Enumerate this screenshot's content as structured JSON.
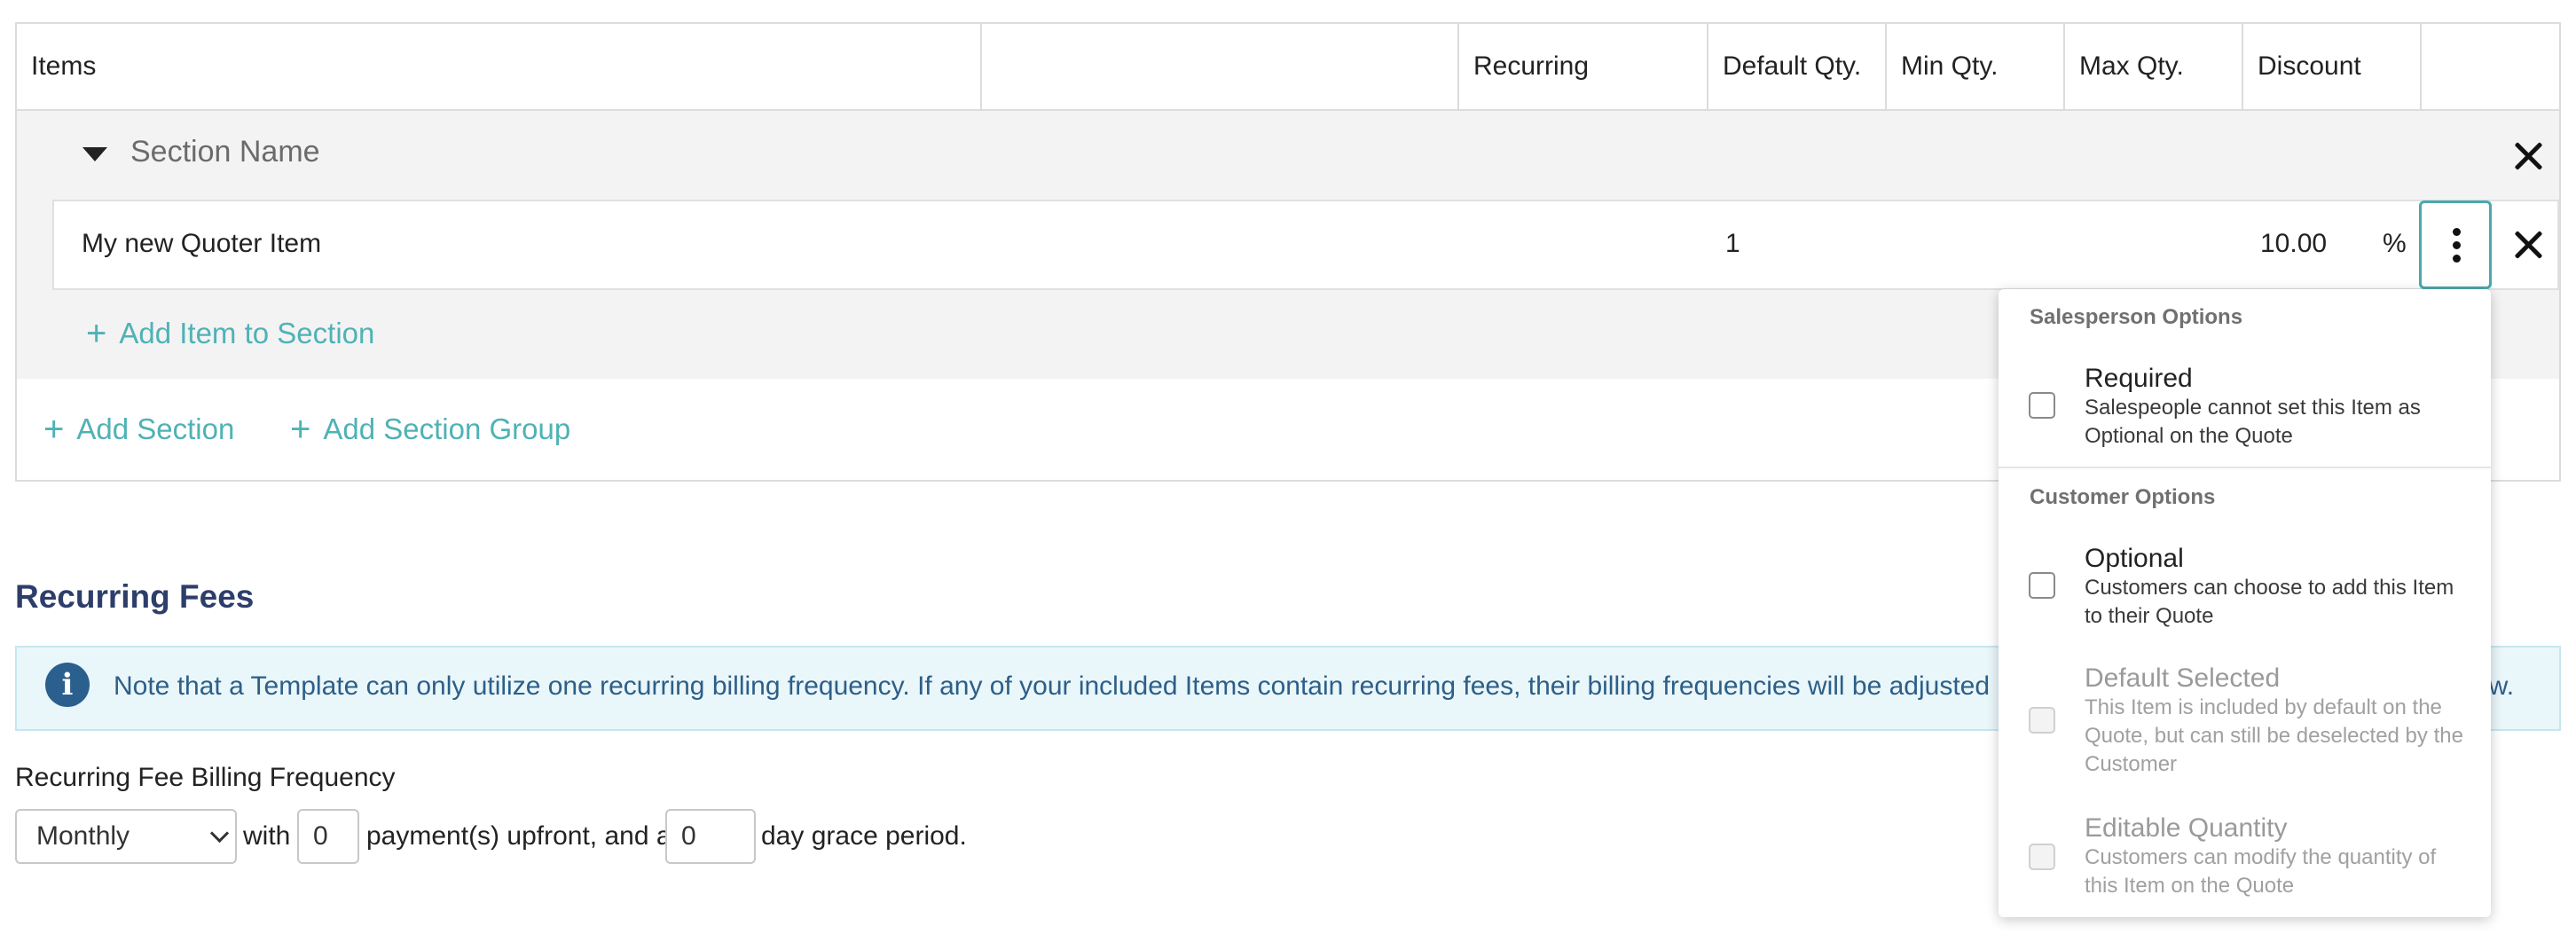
{
  "table": {
    "columns": [
      "Items",
      "",
      "Recurring",
      "Default Qty.",
      "Min Qty.",
      "Max Qty.",
      "Discount",
      ""
    ],
    "section_name": "Section Name",
    "item": {
      "name": "My new Quoter Item",
      "default_qty": "1",
      "discount": "10.00",
      "discount_unit": "%"
    },
    "add_item_to_section": "Add Item to Section",
    "add_section": "Add Section",
    "add_section_group": "Add Section Group"
  },
  "recurring": {
    "title": "Recurring Fees",
    "info": "Note that a Template can only utilize one recurring billing frequency. If any of your included Items contain recurring fees, their billing frequencies will be adjusted in your Q",
    "info_tail": "ow.",
    "frequency_label": "Recurring Fee Billing Frequency",
    "frequency_value": "Monthly",
    "with": "with",
    "upfront_value": "0",
    "upfront_text": "payment(s) upfront, and a",
    "grace_value": "0",
    "grace_text": "day grace period."
  },
  "menu": {
    "salesperson_heading": "Salesperson Options",
    "required_title": "Required",
    "required_desc": "Salespeople cannot set this Item as Optional on the Quote",
    "customer_heading": "Customer Options",
    "optional_title": "Optional",
    "optional_desc": "Customers can choose to add this Item to their Quote",
    "default_title": "Default Selected",
    "default_desc": "This Item is included by default on the Quote, but can still be deselected by the Customer",
    "editable_title": "Editable Quantity",
    "editable_desc": "Customers can modify the quantity of this Item on the Quote"
  },
  "colors": {
    "accent": "#4fb2b6",
    "heading": "#2d3e6b",
    "info_bg": "#e9f6fa",
    "info_text": "#2d5f87"
  },
  "icons": [
    "caret-down-icon",
    "close-icon",
    "more-vertical-icon",
    "plus-icon",
    "info-icon",
    "chevron-down-icon"
  ]
}
